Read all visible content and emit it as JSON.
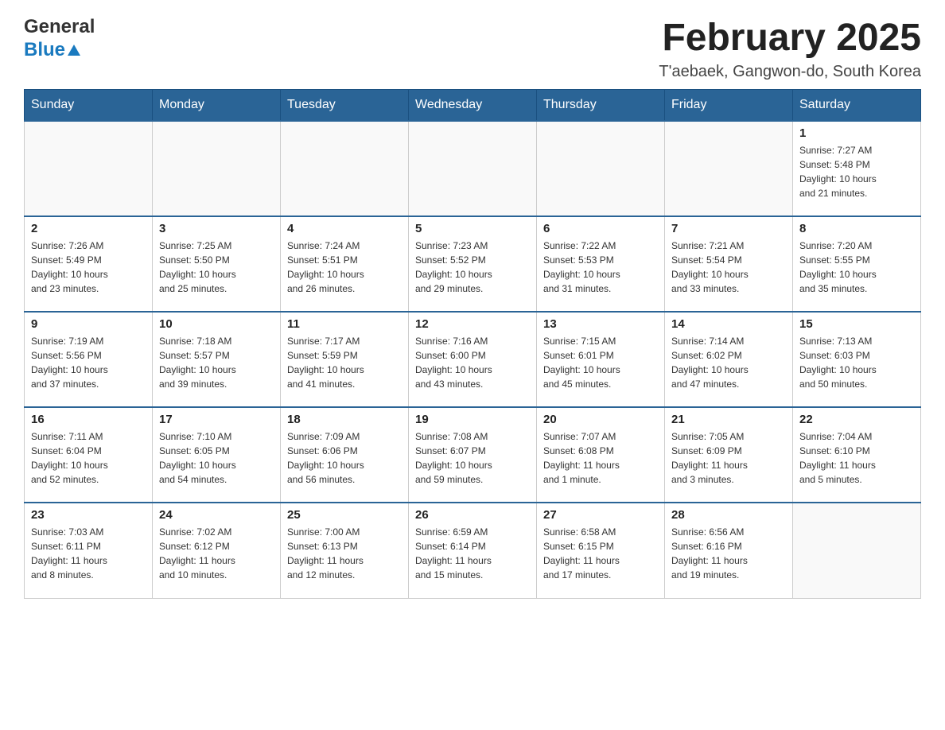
{
  "header": {
    "logo_line1": "General",
    "logo_line2": "Blue",
    "title": "February 2025",
    "subtitle": "T'aebaek, Gangwon-do, South Korea"
  },
  "calendar": {
    "days_of_week": [
      "Sunday",
      "Monday",
      "Tuesday",
      "Wednesday",
      "Thursday",
      "Friday",
      "Saturday"
    ],
    "weeks": [
      [
        {
          "day": "",
          "info": ""
        },
        {
          "day": "",
          "info": ""
        },
        {
          "day": "",
          "info": ""
        },
        {
          "day": "",
          "info": ""
        },
        {
          "day": "",
          "info": ""
        },
        {
          "day": "",
          "info": ""
        },
        {
          "day": "1",
          "info": "Sunrise: 7:27 AM\nSunset: 5:48 PM\nDaylight: 10 hours\nand 21 minutes."
        }
      ],
      [
        {
          "day": "2",
          "info": "Sunrise: 7:26 AM\nSunset: 5:49 PM\nDaylight: 10 hours\nand 23 minutes."
        },
        {
          "day": "3",
          "info": "Sunrise: 7:25 AM\nSunset: 5:50 PM\nDaylight: 10 hours\nand 25 minutes."
        },
        {
          "day": "4",
          "info": "Sunrise: 7:24 AM\nSunset: 5:51 PM\nDaylight: 10 hours\nand 26 minutes."
        },
        {
          "day": "5",
          "info": "Sunrise: 7:23 AM\nSunset: 5:52 PM\nDaylight: 10 hours\nand 29 minutes."
        },
        {
          "day": "6",
          "info": "Sunrise: 7:22 AM\nSunset: 5:53 PM\nDaylight: 10 hours\nand 31 minutes."
        },
        {
          "day": "7",
          "info": "Sunrise: 7:21 AM\nSunset: 5:54 PM\nDaylight: 10 hours\nand 33 minutes."
        },
        {
          "day": "8",
          "info": "Sunrise: 7:20 AM\nSunset: 5:55 PM\nDaylight: 10 hours\nand 35 minutes."
        }
      ],
      [
        {
          "day": "9",
          "info": "Sunrise: 7:19 AM\nSunset: 5:56 PM\nDaylight: 10 hours\nand 37 minutes."
        },
        {
          "day": "10",
          "info": "Sunrise: 7:18 AM\nSunset: 5:57 PM\nDaylight: 10 hours\nand 39 minutes."
        },
        {
          "day": "11",
          "info": "Sunrise: 7:17 AM\nSunset: 5:59 PM\nDaylight: 10 hours\nand 41 minutes."
        },
        {
          "day": "12",
          "info": "Sunrise: 7:16 AM\nSunset: 6:00 PM\nDaylight: 10 hours\nand 43 minutes."
        },
        {
          "day": "13",
          "info": "Sunrise: 7:15 AM\nSunset: 6:01 PM\nDaylight: 10 hours\nand 45 minutes."
        },
        {
          "day": "14",
          "info": "Sunrise: 7:14 AM\nSunset: 6:02 PM\nDaylight: 10 hours\nand 47 minutes."
        },
        {
          "day": "15",
          "info": "Sunrise: 7:13 AM\nSunset: 6:03 PM\nDaylight: 10 hours\nand 50 minutes."
        }
      ],
      [
        {
          "day": "16",
          "info": "Sunrise: 7:11 AM\nSunset: 6:04 PM\nDaylight: 10 hours\nand 52 minutes."
        },
        {
          "day": "17",
          "info": "Sunrise: 7:10 AM\nSunset: 6:05 PM\nDaylight: 10 hours\nand 54 minutes."
        },
        {
          "day": "18",
          "info": "Sunrise: 7:09 AM\nSunset: 6:06 PM\nDaylight: 10 hours\nand 56 minutes."
        },
        {
          "day": "19",
          "info": "Sunrise: 7:08 AM\nSunset: 6:07 PM\nDaylight: 10 hours\nand 59 minutes."
        },
        {
          "day": "20",
          "info": "Sunrise: 7:07 AM\nSunset: 6:08 PM\nDaylight: 11 hours\nand 1 minute."
        },
        {
          "day": "21",
          "info": "Sunrise: 7:05 AM\nSunset: 6:09 PM\nDaylight: 11 hours\nand 3 minutes."
        },
        {
          "day": "22",
          "info": "Sunrise: 7:04 AM\nSunset: 6:10 PM\nDaylight: 11 hours\nand 5 minutes."
        }
      ],
      [
        {
          "day": "23",
          "info": "Sunrise: 7:03 AM\nSunset: 6:11 PM\nDaylight: 11 hours\nand 8 minutes."
        },
        {
          "day": "24",
          "info": "Sunrise: 7:02 AM\nSunset: 6:12 PM\nDaylight: 11 hours\nand 10 minutes."
        },
        {
          "day": "25",
          "info": "Sunrise: 7:00 AM\nSunset: 6:13 PM\nDaylight: 11 hours\nand 12 minutes."
        },
        {
          "day": "26",
          "info": "Sunrise: 6:59 AM\nSunset: 6:14 PM\nDaylight: 11 hours\nand 15 minutes."
        },
        {
          "day": "27",
          "info": "Sunrise: 6:58 AM\nSunset: 6:15 PM\nDaylight: 11 hours\nand 17 minutes."
        },
        {
          "day": "28",
          "info": "Sunrise: 6:56 AM\nSunset: 6:16 PM\nDaylight: 11 hours\nand 19 minutes."
        },
        {
          "day": "",
          "info": ""
        }
      ]
    ]
  }
}
